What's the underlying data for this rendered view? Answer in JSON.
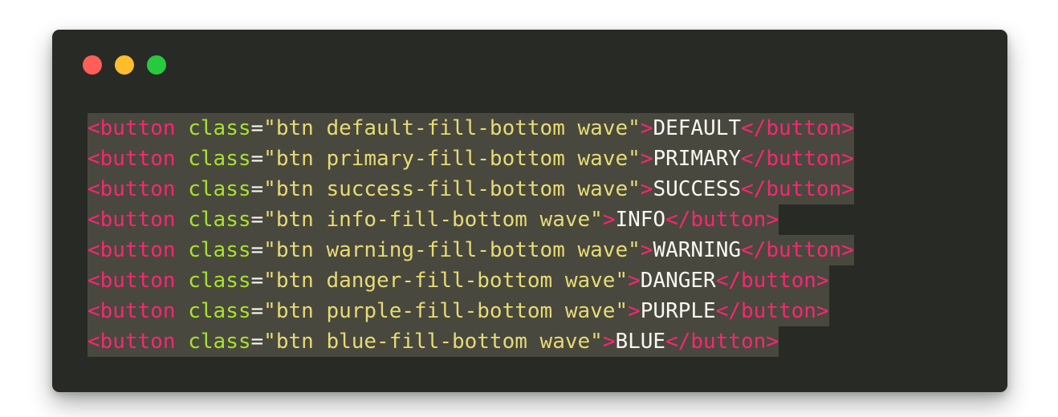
{
  "window": {
    "controls": [
      {
        "name": "close",
        "color": "#ff5f56"
      },
      {
        "name": "minimize",
        "color": "#ffbd2e"
      },
      {
        "name": "maximize",
        "color": "#27c93f"
      }
    ]
  },
  "theme": {
    "background": "#282a26",
    "selection": "#49483e",
    "tag": "#f92672",
    "attribute": "#a6e22e",
    "string": "#e6db74",
    "text": "#f8f8f2"
  },
  "code": {
    "lines": [
      {
        "open": "<button",
        "attr": "class",
        "eq": "=",
        "value": "\"btn default-fill-bottom wave\"",
        "close_open": ">",
        "text": "DEFAULT",
        "end": "</button>"
      },
      {
        "open": "<button",
        "attr": "class",
        "eq": "=",
        "value": "\"btn primary-fill-bottom wave\"",
        "close_open": ">",
        "text": "PRIMARY",
        "end": "</button>"
      },
      {
        "open": "<button",
        "attr": "class",
        "eq": "=",
        "value": "\"btn success-fill-bottom wave\"",
        "close_open": ">",
        "text": "SUCCESS",
        "end": "</button>"
      },
      {
        "open": "<button",
        "attr": "class",
        "eq": "=",
        "value": "\"btn info-fill-bottom wave\"",
        "close_open": ">",
        "text": "INFO",
        "end": "</button>"
      },
      {
        "open": "<button",
        "attr": "class",
        "eq": "=",
        "value": "\"btn warning-fill-bottom wave\"",
        "close_open": ">",
        "text": "WARNING",
        "end": "</button>"
      },
      {
        "open": "<button",
        "attr": "class",
        "eq": "=",
        "value": "\"btn danger-fill-bottom wave\"",
        "close_open": ">",
        "text": "DANGER",
        "end": "</button>"
      },
      {
        "open": "<button",
        "attr": "class",
        "eq": "=",
        "value": "\"btn purple-fill-bottom wave\"",
        "close_open": ">",
        "text": "PURPLE",
        "end": "</button>"
      },
      {
        "open": "<button",
        "attr": "class",
        "eq": "=",
        "value": "\"btn blue-fill-bottom wave\"",
        "close_open": ">",
        "text": "BLUE",
        "end": "</button>"
      }
    ]
  }
}
